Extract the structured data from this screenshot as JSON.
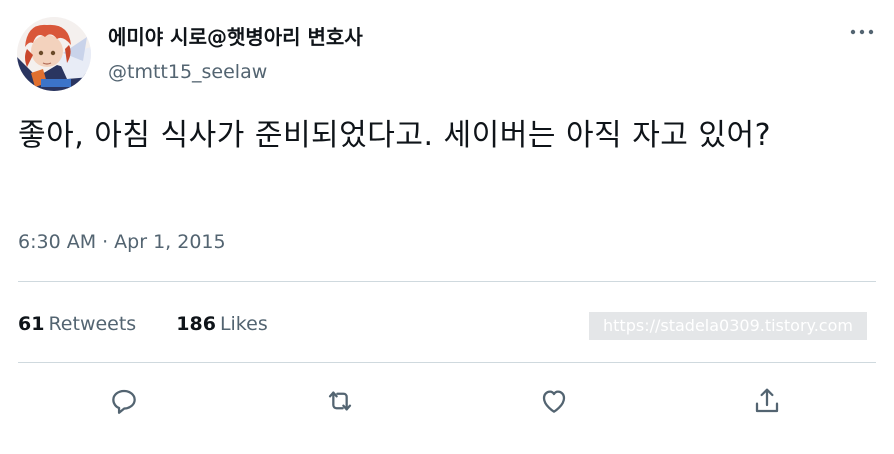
{
  "author": {
    "display_name": "에미야 시로@햇병아리 변호사",
    "handle": "@tmtt15_seelaw",
    "avatar_icon": "avatar-red-hair-character"
  },
  "tweet": {
    "text": "좋아, 아침 식사가 준비되었다고. 세이버는 아직 자고 있어?",
    "time": "6:30 AM",
    "separator": "·",
    "date": "Apr 1, 2015"
  },
  "stats": {
    "retweets_count": "61",
    "retweets_label": "Retweets",
    "likes_count": "186",
    "likes_label": "Likes"
  },
  "watermark": "https://stadela0309.tistory.com",
  "icons": {
    "more": "more-horizontal-icon",
    "reply": "reply-icon",
    "retweet": "retweet-icon",
    "like": "heart-icon",
    "share": "share-icon"
  },
  "colors": {
    "text_primary": "#0f1419",
    "text_secondary": "#536471",
    "divider": "#cfd9de"
  }
}
